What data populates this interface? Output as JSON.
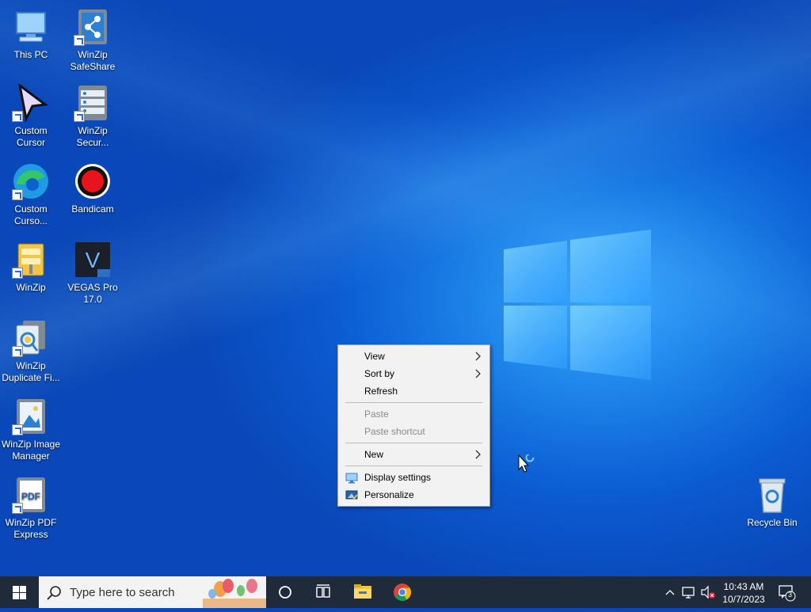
{
  "desktop": {
    "icons": [
      {
        "label": "This PC"
      },
      {
        "label": "WinZip SafeShare"
      },
      {
        "label": "Custom Cursor"
      },
      {
        "label": "WinZip Secur..."
      },
      {
        "label": "Custom Curso..."
      },
      {
        "label": "Bandicam"
      },
      {
        "label": "WinZip"
      },
      {
        "label": "VEGAS Pro 17.0"
      },
      {
        "label": "WinZip Duplicate Fi..."
      },
      {
        "label": "WinZip Image Manager"
      },
      {
        "label": "WinZip PDF Express"
      },
      {
        "label": "Recycle Bin"
      }
    ]
  },
  "context_menu": {
    "items": [
      {
        "label": "View",
        "arrow": ">"
      },
      {
        "label": "Sort by",
        "arrow": ">"
      },
      {
        "label": "Refresh"
      },
      {
        "label": "Paste"
      },
      {
        "label": "Paste shortcut"
      },
      {
        "label": "New",
        "arrow": ">"
      },
      {
        "label": "Display settings"
      },
      {
        "label": "Personalize"
      }
    ]
  },
  "taskbar": {
    "search_placeholder": "Type here to search",
    "clock_time": "10:43 AM",
    "clock_date": "10/7/2023",
    "notification_count": "3"
  },
  "colors": {
    "taskbar": "#1f2a3a",
    "menu_bg": "#f2f2f2",
    "disabled_text": "#8a8a8a"
  }
}
